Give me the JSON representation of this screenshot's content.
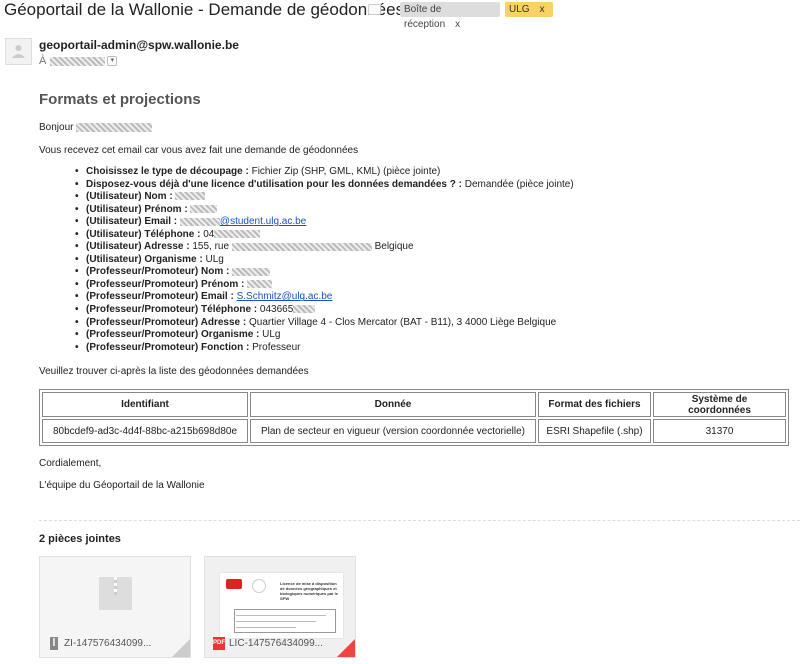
{
  "subject": "Géoportail de la Wallonie - Demande de géodonnées",
  "labels": [
    {
      "text": "Boîte de réception",
      "close": "x"
    },
    {
      "text": "ULG",
      "close": "x",
      "color": "#fad165"
    }
  ],
  "sender": "geoportail-admin@spw.wallonie.be",
  "to_label": "À",
  "body": {
    "title": "Formats et projections",
    "greeting": "Bonjour",
    "intro": "Vous recevez cet email car vous avez fait une demande de géodonnées",
    "fields": [
      {
        "label": "Choisissez le type de découpage :",
        "value": " Fichier Zip (SHP, GML, KML) (pièce jointe)"
      },
      {
        "label": "Disposez-vous déjà d'une licence d'utilisation pour les données demandées ? :",
        "value": " Demandée (pièce jointe)"
      },
      {
        "label": "(Utilisateur) Nom :",
        "value": ""
      },
      {
        "label": "(Utilisateur) Prénom :",
        "value": ""
      },
      {
        "label": "(Utilisateur) Email :",
        "value": "@student.ulg.ac.be"
      },
      {
        "label": "(Utilisateur) Téléphone :",
        "value": " 04"
      },
      {
        "label": "(Utilisateur) Adresse :",
        "value": " 155, rue",
        "value_after": " Belgique"
      },
      {
        "label": "(Utilisateur) Organisme :",
        "value": " ULg"
      },
      {
        "label": "(Professeur/Promoteur) Nom :",
        "value": ""
      },
      {
        "label": "(Professeur/Promoteur) Prénom :",
        "value": ""
      },
      {
        "label": "(Professeur/Promoteur) Email :",
        "value": "S.Schmitz@ulg.ac.be"
      },
      {
        "label": "(Professeur/Promoteur) Téléphone :",
        "value": " 043665"
      },
      {
        "label": "(Professeur/Promoteur) Adresse :",
        "value": " Quartier Village 4 - Clos Mercator (BAT - B11), 3 4000 Liège Belgique"
      },
      {
        "label": "(Professeur/Promoteur) Organisme :",
        "value": " ULg"
      },
      {
        "label": "(Professeur/Promoteur) Fonction :",
        "value": " Professeur"
      }
    ],
    "list_intro": "Veuillez trouver ci-après la liste des géodonnées demandées",
    "table": {
      "headers": [
        "Identifiant",
        "Donnée",
        "Format des fichiers",
        "Système de coordonnées"
      ],
      "rows": [
        [
          "80bcdef9-ad3c-4d4f-88bc-a215b698d80e",
          "Plan de secteur en vigueur (version coordonnée vectorielle)",
          "ESRI Shapefile (.shp)",
          "31370"
        ]
      ]
    },
    "closing": "Cordialement,",
    "signature": "L'équipe du Géoportail de la Wallonie"
  },
  "attachments": {
    "title": "2 pièces jointes",
    "files": [
      {
        "name": "ZI-147576434099...",
        "icon": "zip-file-icon"
      },
      {
        "name": "LIC-147576434099...",
        "icon": "pdf-file-icon",
        "badge": "PDF"
      }
    ],
    "pdf_preview_title": "Licence de mise à disposition de données géographiques et biologiques numériques par le SPW"
  }
}
